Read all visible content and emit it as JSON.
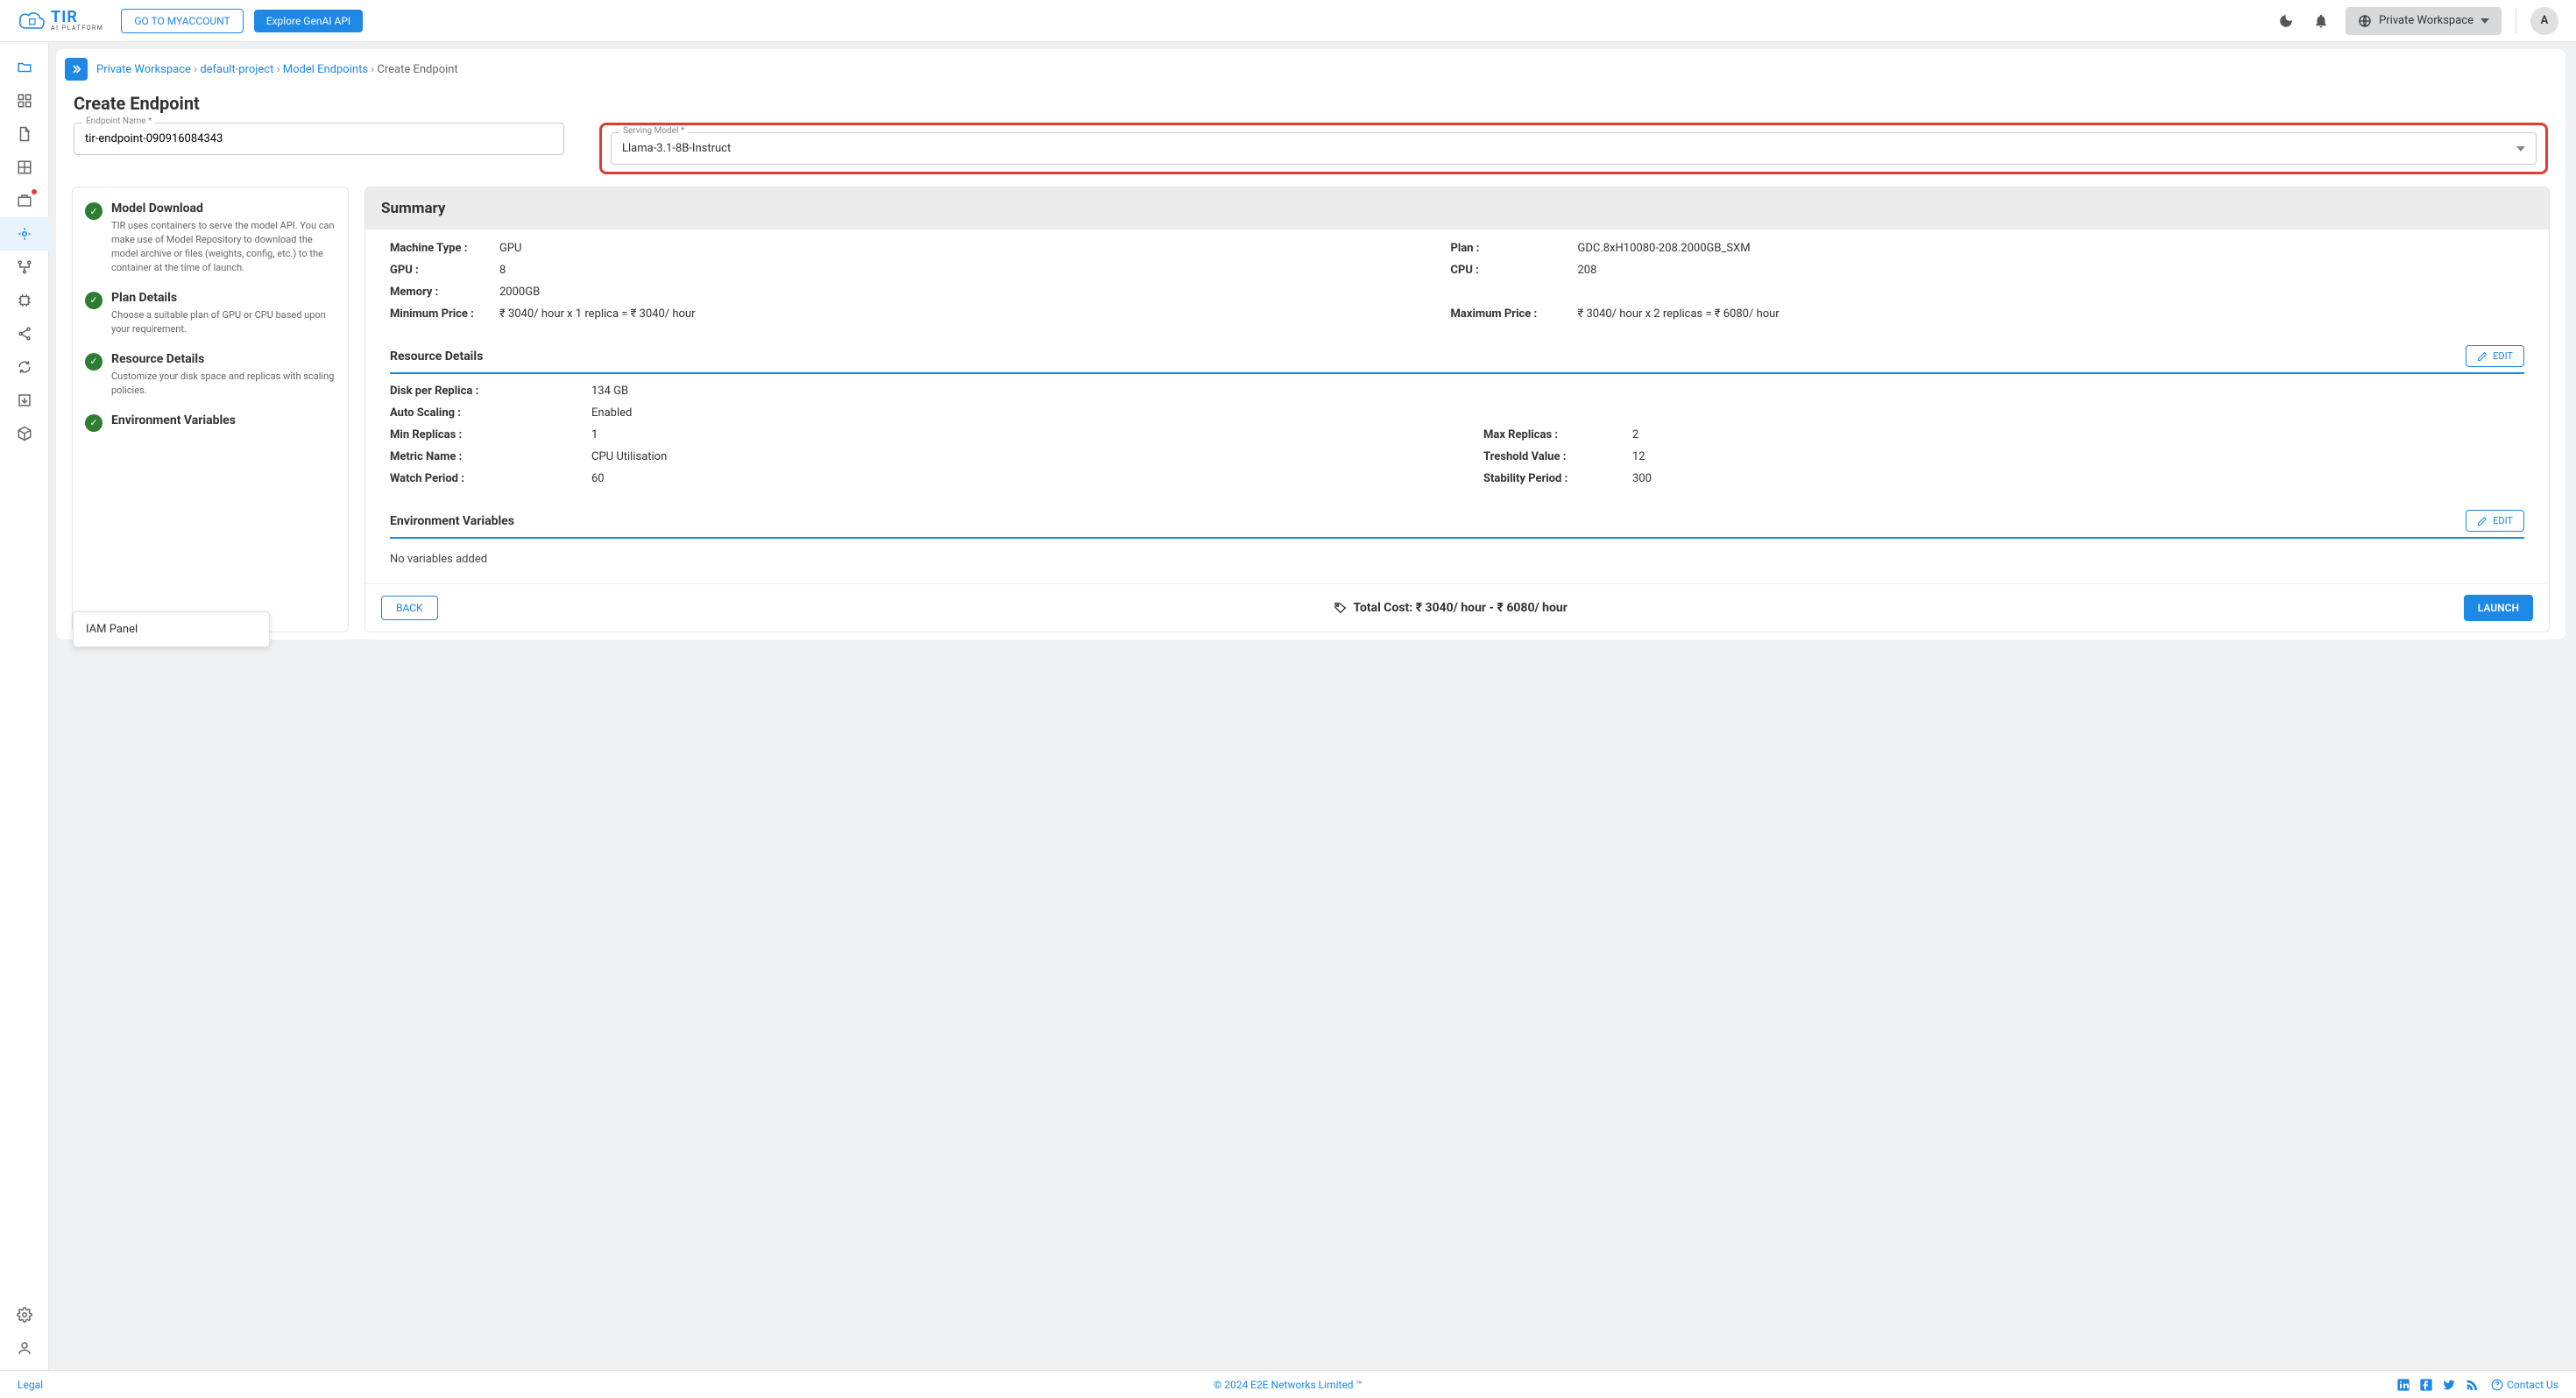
{
  "header": {
    "my_account": "GO TO MYACCOUNT",
    "explore": "Explore GenAI API",
    "workspace": "Private Workspace",
    "avatar": "A"
  },
  "breadcrumb": {
    "items": [
      "Private Workspace",
      "default-project",
      "Model Endpoints",
      "Create Endpoint"
    ]
  },
  "page_title": "Create Endpoint",
  "form": {
    "endpoint_label": "Endpoint Name *",
    "endpoint_value": "tir-endpoint-090916084343",
    "model_label": "Serving Model *",
    "model_value": "Llama-3.1-8B-Instruct"
  },
  "steps": [
    {
      "title": "Model Download",
      "desc": "TIR uses containers to serve the model API. You can make use of Model Repository to download the model archive or files (weights, config, etc.) to the container at the time of launch."
    },
    {
      "title": "Plan Details",
      "desc": "Choose a suitable plan of GPU or CPU based upon your requirement."
    },
    {
      "title": "Resource Details",
      "desc": "Customize your disk space and replicas with scaling policies."
    },
    {
      "title": "Environment Variables",
      "desc": ""
    }
  ],
  "iam_tooltip": "IAM Panel",
  "summary": {
    "title": "Summary",
    "machine_type_k": "Machine Type :",
    "machine_type_v": "GPU",
    "plan_k": "Plan :",
    "plan_v": "GDC.8xH10080-208.2000GB_SXM",
    "gpu_k": "GPU :",
    "gpu_v": "8",
    "cpu_k": "CPU :",
    "cpu_v": "208",
    "memory_k": "Memory :",
    "memory_v": "2000GB",
    "minprice_k": "Minimum Price :",
    "minprice_v": "₹ 3040/ hour x 1 replica = ₹ 3040/ hour",
    "maxprice_k": "Maximum Price :",
    "maxprice_v": "₹ 3040/ hour x 2 replicas = ₹ 6080/ hour",
    "resource_title": "Resource Details",
    "disk_k": "Disk per Replica :",
    "disk_v": "134 GB",
    "autoscale_k": "Auto Scaling :",
    "autoscale_v": "Enabled",
    "minrep_k": "Min Replicas :",
    "minrep_v": "1",
    "maxrep_k": "Max Replicas :",
    "maxrep_v": "2",
    "metric_k": "Metric Name :",
    "metric_v": "CPU Utilisation",
    "thresh_k": "Treshold Value :",
    "thresh_v": "12",
    "watch_k": "Watch Period :",
    "watch_v": "60",
    "stability_k": "Stability Period :",
    "stability_v": "300",
    "env_title": "Environment Variables",
    "no_vars": "No variables added",
    "edit": "EDIT",
    "back": "BACK",
    "total_cost": "Total Cost: ₹ 3040/ hour - ₹ 6080/ hour",
    "launch": "LAUNCH"
  },
  "footer": {
    "legal": "Legal",
    "copy": "© 2024 E2E Networks Limited ™",
    "contact": "Contact Us"
  }
}
